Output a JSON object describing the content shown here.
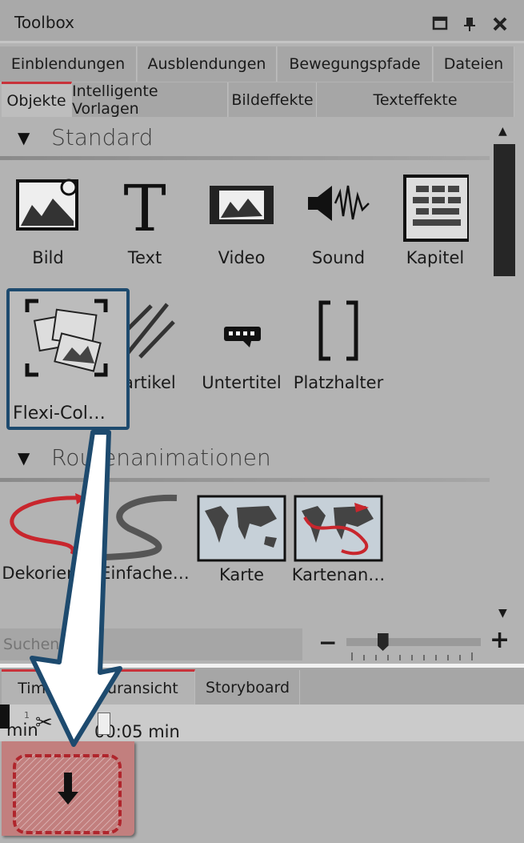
{
  "window": {
    "title": "Toolbox",
    "icons": [
      "maximize-icon",
      "pin-icon",
      "close-icon"
    ]
  },
  "tabs_row1": [
    {
      "label": "Einblendungen"
    },
    {
      "label": "Ausblendungen"
    },
    {
      "label": "Bewegungspfade"
    },
    {
      "label": "Dateien"
    }
  ],
  "tabs_row2": [
    {
      "label": "Objekte",
      "active": true
    },
    {
      "label": "Intelligente Vorlagen"
    },
    {
      "label": "Bildeffekte"
    },
    {
      "label": "Texteffekte"
    }
  ],
  "sections": [
    {
      "title": "Standard",
      "items": [
        {
          "label": "Bild"
        },
        {
          "label": "Text"
        },
        {
          "label": "Video"
        },
        {
          "label": "Sound"
        },
        {
          "label": "Kapitel"
        },
        {
          "label": "Flexi-Col…"
        },
        {
          "label": "Partikel"
        },
        {
          "label": "Untertitel"
        },
        {
          "label": "Platzhalter"
        }
      ]
    },
    {
      "title": "Routenanimationen",
      "items": [
        {
          "label": "Dekorieren"
        },
        {
          "label": "Einfache…"
        },
        {
          "label": "Karte"
        },
        {
          "label": "Kartenan…"
        }
      ]
    }
  ],
  "search": {
    "placeholder": "Suchen"
  },
  "zoom": {
    "minus": "−",
    "plus": "+",
    "level": 0.2
  },
  "bottom_tabs": [
    {
      "label": "Timeline-Spuransicht",
      "active": true
    },
    {
      "label": "Storyboard"
    }
  ],
  "ruler": {
    "start": "0 min",
    "mark": "00:05 min",
    "tick1": "1",
    "tick2": "2"
  },
  "colors": {
    "accent": "#c8323a",
    "highlight_border": "#1d4a6e",
    "drop_zone": "#c27f7e"
  }
}
